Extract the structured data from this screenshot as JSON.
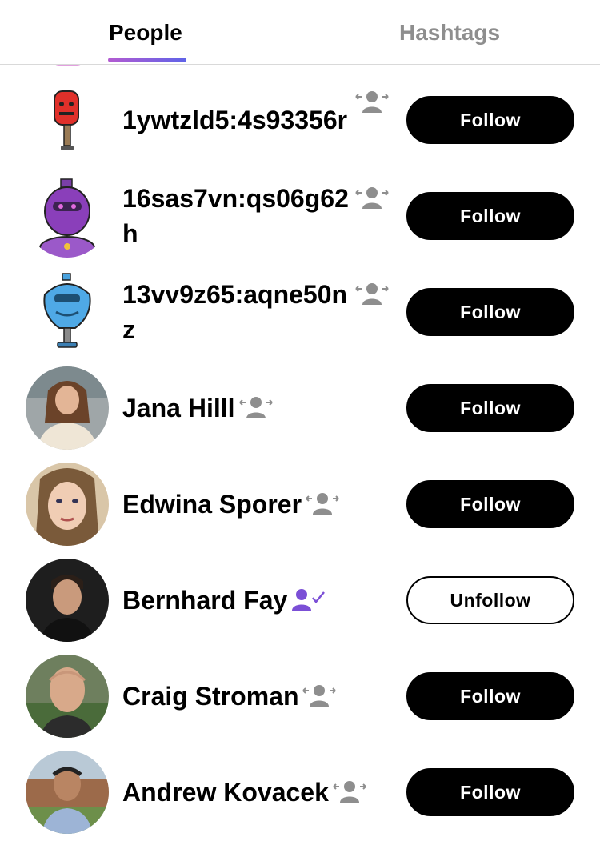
{
  "tabs": {
    "people": "People",
    "hashtags": "Hashtags",
    "active": "people"
  },
  "accent": {
    "gradient_start": "#b35bd1",
    "gradient_end": "#5f63e8",
    "following_icon": "#7b4fd6",
    "neutral_icon": "#8e8e8e"
  },
  "people": [
    {
      "name": "1ywtzld5:4s93356r",
      "avatar": "red-robot-avatar",
      "relation": "follow-request-icon",
      "button": "Follow"
    },
    {
      "name": "16sas7vn:qs06g62h",
      "avatar": "purple-robot-avatar",
      "relation": "follow-request-icon",
      "button": "Follow"
    },
    {
      "name": "13vv9z65:aqne50nz",
      "avatar": "blue-robot-avatar",
      "relation": "follow-request-icon",
      "button": "Follow"
    },
    {
      "name": "Jana Hilll",
      "avatar": "user-photo-avatar",
      "relation": "follow-request-icon",
      "button": "Follow"
    },
    {
      "name": "Edwina Sporer",
      "avatar": "user-photo-avatar",
      "relation": "follow-request-icon",
      "button": "Follow"
    },
    {
      "name": "Bernhard Fay",
      "avatar": "user-photo-avatar",
      "relation": "following-check-icon",
      "button": "Unfollow"
    },
    {
      "name": "Craig Stroman",
      "avatar": "user-photo-avatar",
      "relation": "follow-request-icon",
      "button": "Follow"
    },
    {
      "name": "Andrew Kovacek",
      "avatar": "user-photo-avatar",
      "relation": "follow-request-icon",
      "button": "Follow"
    }
  ]
}
